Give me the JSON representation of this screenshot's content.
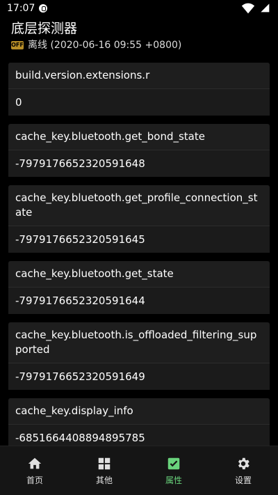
{
  "status_bar": {
    "time": "17:07",
    "battery_icon": "battery-icon",
    "wifi_icon": "wifi-icon"
  },
  "header": {
    "title": "底层探测器",
    "status_icon_text": "OFF",
    "status_text": "离线 (2020-06-16 09:55 +0800)"
  },
  "items": [
    {
      "key": "build.version.extensions.r",
      "value": "0"
    },
    {
      "key": "cache_key.bluetooth.get_bond_state",
      "value": "-7979176652320591648"
    },
    {
      "key": "cache_key.bluetooth.get_profile_connection_state",
      "value": "-7979176652320591645"
    },
    {
      "key": "cache_key.bluetooth.get_state",
      "value": "-7979176652320591644"
    },
    {
      "key": "cache_key.bluetooth.is_offloaded_filtering_supported",
      "value": "-7979176652320591649"
    },
    {
      "key": "cache_key.display_info",
      "value": "-6851664408894895785"
    }
  ],
  "nav": [
    {
      "label": "首页",
      "icon": "home-icon"
    },
    {
      "label": "其他",
      "icon": "grid-icon"
    },
    {
      "label": "属性",
      "icon": "check-icon"
    },
    {
      "label": "设置",
      "icon": "gear-icon"
    }
  ],
  "colors": {
    "active": "#69d37c",
    "card": "#1e1e1e",
    "background": "#000000"
  }
}
